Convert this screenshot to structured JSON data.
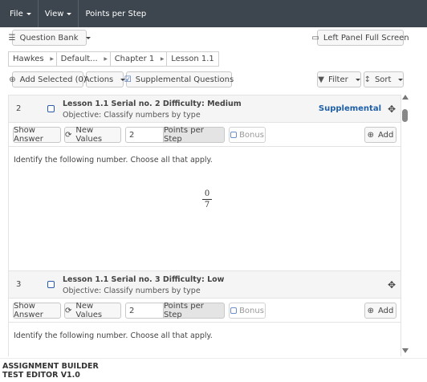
{
  "menu": {
    "file": "File",
    "view": "View",
    "points_per_step": "Points per Step"
  },
  "toolbar": {
    "question_bank": "Question Bank",
    "left_panel_full_screen": "Left Panel Full Screen",
    "add_selected": "Add Selected (0)",
    "actions": "Actions",
    "supplemental_questions": "Supplemental Questions",
    "filter": "Filter",
    "sort": "Sort"
  },
  "breadcrumbs": [
    "Hawkes",
    "Default...",
    "Chapter 1",
    "Lesson 1.1"
  ],
  "questions": [
    {
      "number": "2",
      "title": "Lesson 1.1 Serial no. 2 Difficulty: Medium",
      "objective": "Objective: Classify numbers by type",
      "badge": "Supplemental",
      "show_answer": "Show Answer",
      "new_values": "New Values",
      "points_value": "2",
      "points_label": "Points per Step",
      "bonus": "Bonus",
      "add": "Add",
      "prompt": "Identify the following number. Choose all that apply.",
      "fraction_num": "0",
      "fraction_den": "7"
    },
    {
      "number": "3",
      "title": "Lesson 1.1 Serial no. 3 Difficulty: Low",
      "objective": "Objective: Classify numbers by type",
      "show_answer": "Show Answer",
      "new_values": "New Values",
      "points_value": "2",
      "points_label": "Points per Step",
      "bonus": "Bonus",
      "add": "Add",
      "prompt": "Identify the following number. Choose all that apply."
    }
  ],
  "footer": {
    "line1": "ASSIGNMENT BUILDER",
    "line2": "TEST EDITOR V1.0"
  },
  "colors": {
    "topbar": "#3d464f",
    "accent": "#1e5fa8"
  }
}
